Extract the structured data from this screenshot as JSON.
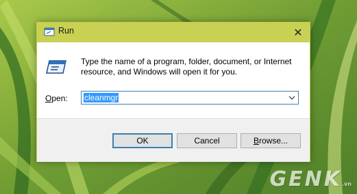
{
  "window": {
    "title": "Run",
    "close_glyph": "✕",
    "title_icon": "run-icon"
  },
  "dialog": {
    "description": "Type the name of a program, folder, document, or Internet resource, and Windows will open it for you.",
    "open_label_mnemonic": "O",
    "open_label_rest": "pen:",
    "input_value": "cleanmgr",
    "buttons": {
      "ok": "OK",
      "cancel": "Cancel",
      "browse_mnemonic": "B",
      "browse_rest": "rowse..."
    }
  },
  "watermark": {
    "text": "GENK",
    "suffix": ".vn"
  },
  "colors": {
    "titlebar": "#c8d153",
    "input_border": "#3c7fb1",
    "selection": "#3399ff",
    "footer": "#f0f0f0"
  }
}
